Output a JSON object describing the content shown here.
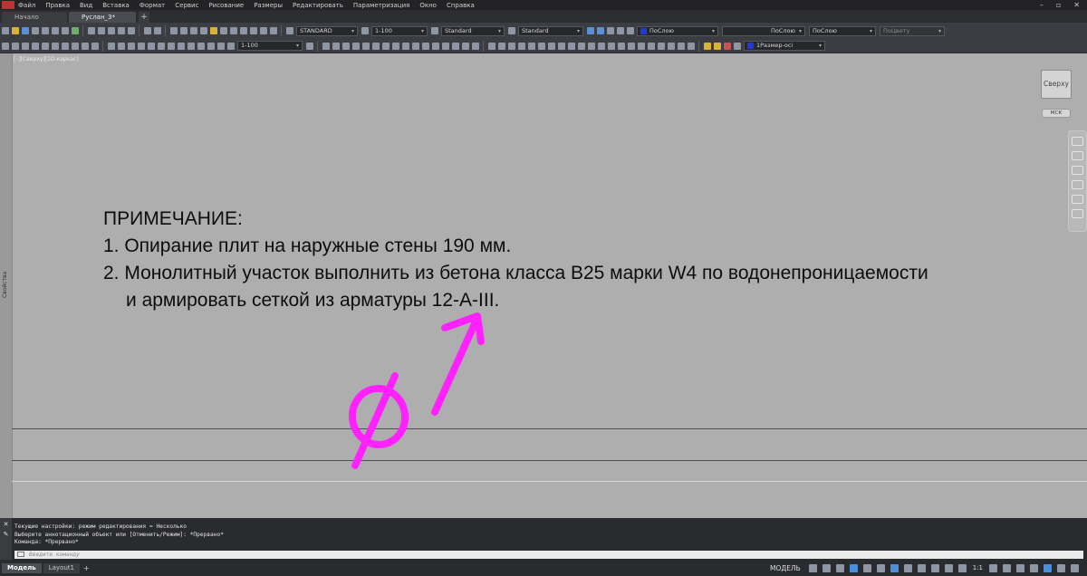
{
  "menubar": {
    "items": [
      "Файл",
      "Правка",
      "Вид",
      "Вставка",
      "Формат",
      "Сервис",
      "Рисование",
      "Размеры",
      "Редактировать",
      "Параметризация",
      "Окно",
      "Справка"
    ]
  },
  "tabs": {
    "items": [
      {
        "label": "Начало"
      },
      {
        "label": "Руслан_3*"
      }
    ],
    "plus": "+"
  },
  "toolbar1": {
    "text_style": "STANDARD",
    "annotation_scale": "1-100",
    "table_style": "Standard",
    "multileader_style": "Standard",
    "color": "ПоСлою",
    "linetype": "ПоСлою",
    "lineweight": "ПоСлою",
    "plotstyle": "ПоЦвету"
  },
  "toolbar2": {
    "scale": "1-100",
    "layer": "1Размер-осі"
  },
  "viewport": {
    "label": "[–][Сверху][2D-каркас]",
    "viewcube_label": "Сверху",
    "wcs_label": "МСК",
    "side_panel_label": "Свойства"
  },
  "note": {
    "title": "ПРИМЕЧАНИЕ:",
    "line1": "1. Опирание плит на наружные стены 190 мм.",
    "line2": "2. Монолитный участок выполнить из бетона класса В25 марки W4 по водонепроницаемости",
    "line3": "и армировать сеткой из арматуры 12-А-III."
  },
  "annotation": {
    "color": "#ff22ff",
    "symbol": "diameter-sign",
    "arrow": "pointing-up-right"
  },
  "command": {
    "history": [
      "Текущие настройки: режим редактирования = Несколько",
      "Выберите аннотационный объект или [Отменить/Режим]: *Прервано*",
      "Команда: *Прервано*"
    ],
    "placeholder": "Введите команду"
  },
  "status": {
    "tabs": [
      {
        "label": "Модель"
      },
      {
        "label": "Layout1"
      }
    ],
    "plus": "+",
    "model_label": "МОДЕЛЬ",
    "scale": "1:1"
  },
  "icons": {
    "close": "close-icon",
    "wrench": "wrench-icon"
  }
}
